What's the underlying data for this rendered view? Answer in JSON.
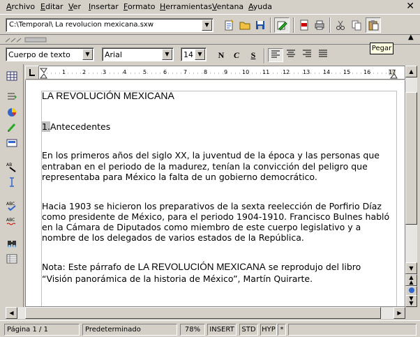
{
  "menubar": {
    "items": [
      "Archivo",
      "Editar",
      "Ver",
      "Insertar",
      "Formato",
      "Herramientas",
      "Ventana",
      "Ayuda"
    ],
    "close_symbol": "✕"
  },
  "functionbar": {
    "url": "C:\\Temporal\\ La revolucion mexicana.sxw",
    "icons": [
      "edit-file-icon",
      "open-folder-icon",
      "save-icon",
      "edit-mode-icon",
      "export-pdf-icon",
      "print-icon",
      "cut-icon",
      "copy-icon",
      "paste-icon"
    ]
  },
  "tooltip": {
    "text": "Pegar"
  },
  "objectbar": {
    "style": "Cuerpo de texto",
    "font": "Arial",
    "size": "14",
    "bold": "N",
    "italic": "C",
    "underline": "S"
  },
  "ruler": {
    "labels": [
      "1",
      "2",
      "3",
      "4",
      "5",
      "6",
      "7",
      "8",
      "9",
      "10",
      "11",
      "12",
      "13",
      "14",
      "15",
      "16",
      "17"
    ]
  },
  "document": {
    "title": "LA REVOLUCIÓN MEXICANA",
    "heading_number": "1.",
    "heading_text": "Antecedentes",
    "para1": [
      "En los primeros años del siglo XX, la juventud de la época y las personas que",
      "entraban en el periodo de la madurez, tenían la convicción del peligro que",
      "representaba para México la falta de un gobierno democrático."
    ],
    "para2": [
      "Hacia 1903 se hicieron los preparativos de la sexta reelección de Porfirio Díaz",
      "como presidente de México, para el periodo 1904-1910. Francisco Bulnes habló",
      "en la Cámara de Diputados como miembro de este cuerpo legislativo y a",
      "nombre de los delegados de varios estados de la República."
    ],
    "note_prefix": "Nota: Este párrafo de ",
    "note_title": "LA REVOLUCIÓN MEXICANA",
    "note_suffix": " se reprodujo del libro",
    "note_line2": "“Visión panorámica de la historia de México”, Martín Quirarte."
  },
  "statusbar": {
    "page": "Página  1 / 1",
    "style": "Predeterminado",
    "zoom": "78%",
    "insert": "INSERT",
    "std": "STD",
    "hyp": "HYP",
    "modified": "*"
  }
}
